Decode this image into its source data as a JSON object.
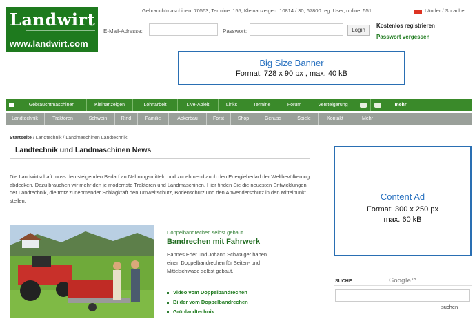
{
  "logo": {
    "mark": "Landwirt",
    "url": "www.landwirt.com"
  },
  "topbar": {
    "info": "Gebrauchtmaschinen: 70563, Termine: 155, Kleinanzeigen: 10814 / 30, 67800 reg. User, online: 551",
    "language": "Länder / Sprache",
    "email_label": "E-Mail-Adresse:",
    "password_label": "Passwort:",
    "login_label": "Login",
    "register_label": "Kostenlos registrieren",
    "forgot_label": "Passwort vergessen"
  },
  "banner": {
    "title": "Big Size Banner",
    "format": "Format: 728 x 90 px , max. 40 kB"
  },
  "nav_primary": [
    "Gebrauchtmaschinen",
    "Kleinanzeigen",
    "Lohnarbeit",
    "Live-Ableit",
    "Links",
    "Termine",
    "Forum",
    "Versteigerung"
  ],
  "nav_more": "mehr",
  "nav_secondary": [
    "Landtechnik",
    "Traktoren",
    "Schwein",
    "Rind",
    "Familie",
    "Ackerbau",
    "Forst",
    "Shop",
    "Genuss",
    "Spiele",
    "Kontakt",
    "Mehr"
  ],
  "breadcrumb": {
    "root": "Startseite",
    "path": " / Landtechnik / Landmaschinen Landtechnik"
  },
  "page_title": "Landtechnik und Landmaschinen News",
  "intro": "Die Landwirtschaft muss den steigenden Bedarf an Nahrungsmitteln und zunehmend auch den Energiebedarf der Weltbevölkerung abdecken. Dazu brauchen wir mehr den je modernste Traktoren und Landmaschinen. Hier finden Sie die neuesten Entwicklungen der Landtechnik, die trotz zunehmender Schlagkraft den Umweltschutz, Bodenschutz und den Anwenderschutz in den Mittelpunkt stellen.",
  "content_ad": {
    "title": "Content Ad",
    "format": "Format: 300 x 250 px",
    "size": "max. 60 kB"
  },
  "article": {
    "kicker": "Doppelbandrechen selbst gebaut",
    "headline": "Bandrechen mit Fahrwerk",
    "summary": "Hannes Eder und Johann Schwaiger haben einen Doppelbandrechen für Seiten- und Mittelschwade selbst gebaut.",
    "links": [
      "Video vom Doppelbandrechen",
      "Bilder vom Doppelbandrechen",
      "Grünlandtechnik"
    ]
  },
  "search": {
    "label": "SUCHE",
    "google": "Google™",
    "button": "suchen",
    "value": ""
  },
  "colors": {
    "brand_green": "#1e7a1e",
    "nav_green": "#3a8a2a",
    "nav_gray": "#9aa09a",
    "ad_blue": "#2a6fb3"
  }
}
